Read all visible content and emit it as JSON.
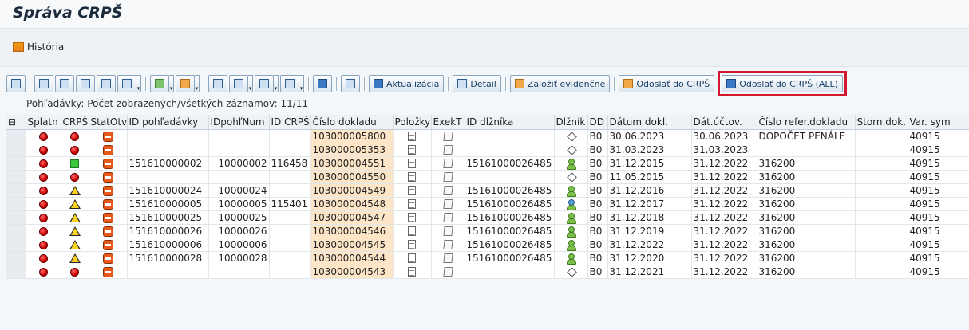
{
  "page": {
    "title": "Správa CRPŠ"
  },
  "app_toolbar": {
    "historia_label": "História"
  },
  "grid_toolbar": {
    "buttons": [
      {
        "name": "details-button",
        "icon": "magnifier-icon",
        "label": ""
      },
      {
        "name": "sort-asc-button",
        "icon": "sort-ascending-icon",
        "label": ""
      },
      {
        "name": "sort-desc-button",
        "icon": "sort-descending-icon",
        "label": ""
      },
      {
        "name": "find-button",
        "icon": "binoculars-icon",
        "label": ""
      },
      {
        "name": "find-next-button",
        "icon": "binoculars-next-icon",
        "label": ""
      },
      {
        "name": "filter-button",
        "icon": "filter-icon",
        "label": ""
      },
      {
        "name": "sum-button",
        "icon": "sum-icon",
        "label": ""
      },
      {
        "name": "subtotal-button",
        "icon": "subtotal-icon",
        "label": ""
      },
      {
        "name": "print-button",
        "icon": "print-icon",
        "label": ""
      },
      {
        "name": "view-button",
        "icon": "view-icon",
        "label": ""
      },
      {
        "name": "export-button",
        "icon": "export-icon",
        "label": ""
      },
      {
        "name": "layout-button",
        "icon": "layout-grid-icon",
        "label": ""
      },
      {
        "name": "info-button",
        "icon": "info-icon",
        "label": ""
      },
      {
        "name": "list-button",
        "icon": "list-icon",
        "label": ""
      }
    ],
    "aktualizacia_label": "Aktualizácia",
    "detail_label": "Detail",
    "zalozit_label": "Založiť evidenčne",
    "odoslat_label": "Odoslať do CRPŠ",
    "odoslat_all_label": "Odoslať do CRPŠ (ALL)"
  },
  "grid": {
    "count_text": "Pohľadávky: Počet zobrazených/všetkých záznamov: 11/11",
    "columns": [
      "Splatn",
      "CRPŠ",
      "StatOtv",
      "ID pohľadávky",
      "IDpohľNum",
      "ID CRPŠ",
      "Číslo dokladu",
      "Položky",
      "ExekT",
      "ID dlžníka",
      "Dlžník",
      "DD",
      "Dátum dokl.",
      "Dát.účtov.",
      "Číslo refer.dokladu",
      "Storn.dok.",
      "Var. sym"
    ],
    "rows": [
      {
        "crps": "red",
        "id_pohl": "",
        "id_pohl_num": "",
        "id_crps": "",
        "cislo": "103000005800",
        "id_dlznika": "",
        "dlznik": "none",
        "dd": "B0",
        "datum": "30.06.2023",
        "dat_uct": "30.06.2023",
        "refer": "DOPOČET PENÁLE",
        "storn": "",
        "var": "40915"
      },
      {
        "crps": "red",
        "id_pohl": "",
        "id_pohl_num": "",
        "id_crps": "",
        "cislo": "103000005353",
        "id_dlznika": "",
        "dlznik": "none",
        "dd": "B0",
        "datum": "31.03.2023",
        "dat_uct": "31.03.2023",
        "refer": "",
        "storn": "",
        "var": "40915"
      },
      {
        "crps": "green",
        "id_pohl": "151610000002",
        "id_pohl_num": "10000002",
        "id_crps": "116458",
        "cislo": "103000004551",
        "id_dlznika": "15161000026485",
        "dlznik": "person",
        "dd": "B0",
        "datum": "31.12.2015",
        "dat_uct": "31.12.2022",
        "refer": "316200",
        "storn": "",
        "var": "40915"
      },
      {
        "crps": "red",
        "id_pohl": "",
        "id_pohl_num": "",
        "id_crps": "",
        "cislo": "103000004550",
        "id_dlznika": "",
        "dlznik": "none",
        "dd": "B0",
        "datum": "11.05.2015",
        "dat_uct": "31.12.2022",
        "refer": "316200",
        "storn": "",
        "var": "40915"
      },
      {
        "crps": "yellow",
        "id_pohl": "151610000024",
        "id_pohl_num": "10000024",
        "id_crps": "",
        "cislo": "103000004549",
        "id_dlznika": "15161000026485",
        "dlznik": "person",
        "dd": "B0",
        "datum": "31.12.2016",
        "dat_uct": "31.12.2022",
        "refer": "316200",
        "storn": "",
        "var": "40915"
      },
      {
        "crps": "yellow",
        "id_pohl": "151610000005",
        "id_pohl_num": "10000005",
        "id_crps": "115401",
        "cislo": "103000004548",
        "id_dlznika": "15161000026485",
        "dlznik": "multi",
        "dd": "B0",
        "datum": "31.12.2017",
        "dat_uct": "31.12.2022",
        "refer": "316200",
        "storn": "",
        "var": "40915"
      },
      {
        "crps": "yellow",
        "id_pohl": "151610000025",
        "id_pohl_num": "10000025",
        "id_crps": "",
        "cislo": "103000004547",
        "id_dlznika": "15161000026485",
        "dlznik": "person",
        "dd": "B0",
        "datum": "31.12.2018",
        "dat_uct": "31.12.2022",
        "refer": "316200",
        "storn": "",
        "var": "40915"
      },
      {
        "crps": "yellow",
        "id_pohl": "151610000026",
        "id_pohl_num": "10000026",
        "id_crps": "",
        "cislo": "103000004546",
        "id_dlznika": "15161000026485",
        "dlznik": "person",
        "dd": "B0",
        "datum": "31.12.2019",
        "dat_uct": "31.12.2022",
        "refer": "316200",
        "storn": "",
        "var": "40915"
      },
      {
        "crps": "yellow",
        "id_pohl": "151610000006",
        "id_pohl_num": "10000006",
        "id_crps": "",
        "cislo": "103000004545",
        "id_dlznika": "15161000026485",
        "dlznik": "person",
        "dd": "B0",
        "datum": "31.12.2022",
        "dat_uct": "31.12.2022",
        "refer": "316200",
        "storn": "",
        "var": "40915"
      },
      {
        "crps": "yellow",
        "id_pohl": "151610000028",
        "id_pohl_num": "10000028",
        "id_crps": "",
        "cislo": "103000004544",
        "id_dlznika": "15161000026485",
        "dlznik": "person",
        "dd": "B0",
        "datum": "31.12.2020",
        "dat_uct": "31.12.2022",
        "refer": "316200",
        "storn": "",
        "var": "40915"
      },
      {
        "crps": "red",
        "id_pohl": "",
        "id_pohl_num": "",
        "id_crps": "",
        "cislo": "103000004543",
        "id_dlznika": "",
        "dlznik": "none",
        "dd": "B0",
        "datum": "31.12.2021",
        "dat_uct": "31.12.2022",
        "refer": "316200",
        "storn": "",
        "var": "40915"
      }
    ]
  },
  "colors": {
    "highlight_border": "#d0192f",
    "key_column_bg": "#fde5c8",
    "status_red": "#d00000",
    "status_green": "#3cc83c",
    "status_yellow": "#ffd21f"
  }
}
